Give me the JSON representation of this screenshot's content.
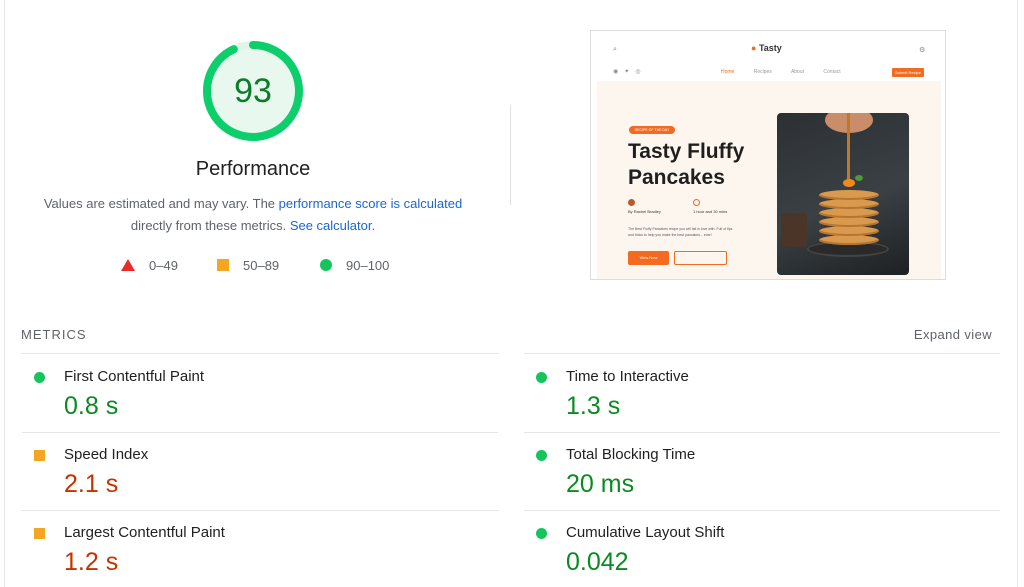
{
  "gauge": {
    "score": "93",
    "score_fraction": 0.93,
    "title": "Performance",
    "color": "#0cce6b"
  },
  "description": {
    "text_before": "Values are estimated and may vary. The ",
    "link1": "performance score is calculated",
    "text_middle": " directly from these metrics. ",
    "link2": "See calculator",
    "text_after": "."
  },
  "legend": {
    "poor": "0–49",
    "average": "50–89",
    "good": "90–100"
  },
  "thumbnail": {
    "logo": "Tasty",
    "nav_links": [
      "Home",
      "Recipes",
      "About",
      "Contact"
    ],
    "nav_cta": "Submit Recipe",
    "badge": "RECIPE OF THE DAY",
    "title": "Tasty Fluffy Pancakes",
    "author": "By Rachel Bradley",
    "time": "1 hour and 30 mins",
    "body": "The Best Fluffy Pancakes recipe you will fall in love with. Full of tips and tricks to help you make the best pancakes... ever!",
    "button": "View Now"
  },
  "metrics": {
    "heading": "METRICS",
    "expand": "Expand view",
    "items": [
      {
        "label": "First Contentful Paint",
        "value": "0.8 s",
        "status": "good"
      },
      {
        "label": "Time to Interactive",
        "value": "1.3 s",
        "status": "good"
      },
      {
        "label": "Speed Index",
        "value": "2.1 s",
        "status": "average"
      },
      {
        "label": "Total Blocking Time",
        "value": "20 ms",
        "status": "good"
      },
      {
        "label": "Largest Contentful Paint",
        "value": "1.2 s",
        "status": "average"
      },
      {
        "label": "Cumulative Layout Shift",
        "value": "0.042",
        "status": "good"
      }
    ]
  },
  "colors": {
    "good": "#0cce6b",
    "average": "#ffa400",
    "poor": "#ff4e42",
    "link": "#1a73e8"
  }
}
